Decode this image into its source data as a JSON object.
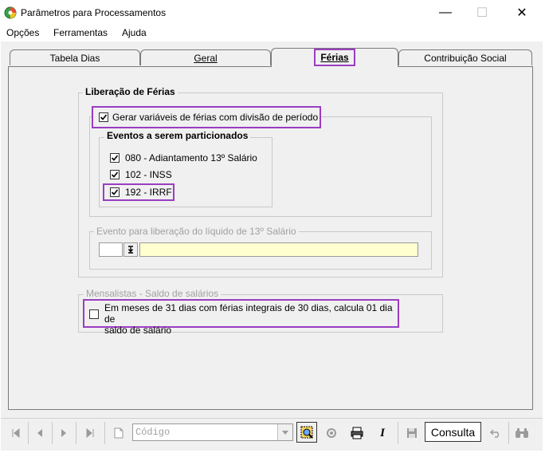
{
  "window": {
    "title": "Parâmetros para Processamentos",
    "minimize": "—",
    "maximize": "☐",
    "close": "✕"
  },
  "menu": [
    "Opções",
    "Ferramentas",
    "Ajuda"
  ],
  "tabs": [
    {
      "label": "Tabela Dias",
      "active": false
    },
    {
      "label": "Geral",
      "active": false
    },
    {
      "label": "Férias",
      "active": true
    },
    {
      "label": "Contribuição Social",
      "active": false
    }
  ],
  "liberacao": {
    "title": "Liberação de Férias",
    "gerar_label": "Gerar variáveis de férias com divisão de período",
    "gerar_checked": true,
    "eventos_title": "Eventos a serem particionados",
    "eventos": [
      {
        "label": "080 - Adiantamento 13º Salário",
        "checked": true
      },
      {
        "label": "102 - INSS",
        "checked": true
      },
      {
        "label": "192 - IRRF",
        "checked": true
      }
    ],
    "evento_liquido_title": "Evento para liberação do líquido de 13º Salário",
    "evento_code": "",
    "evento_desc": ""
  },
  "mensalistas": {
    "title": "Mensalistas - Saldo de salários",
    "option_line1": "Em meses de 31 dias com férias integrais de 30 dias, calcula 01 dia de",
    "option_line2": "saldo de salário",
    "checked": false
  },
  "toolbar": {
    "codigo_placeholder": "Código",
    "consulta_label": "Consulta"
  }
}
